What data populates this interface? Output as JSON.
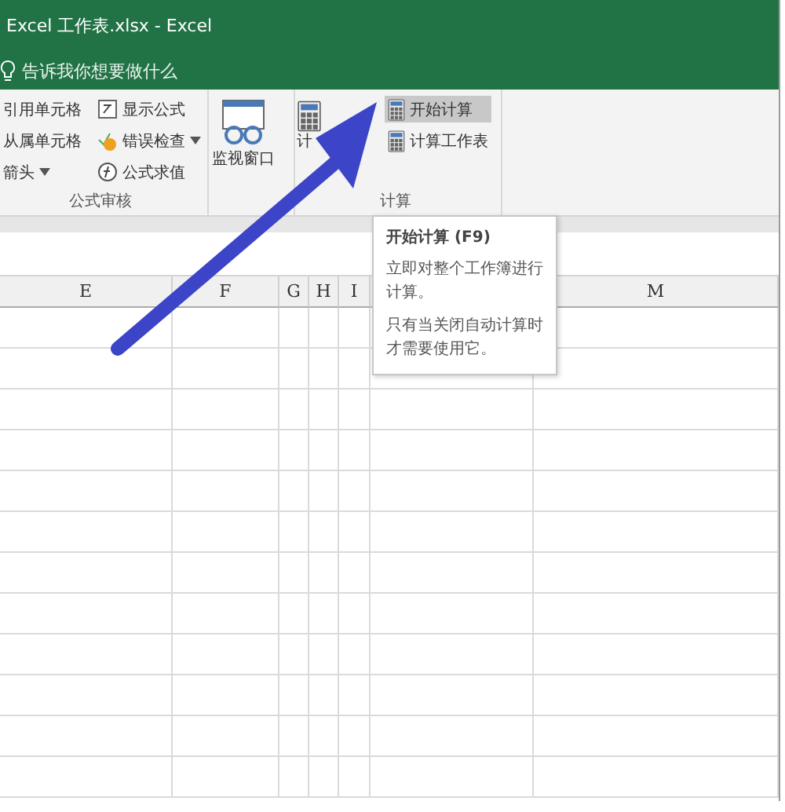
{
  "window": {
    "title": "Excel 工作表.xlsx  -  Excel"
  },
  "tell_me": {
    "placeholder": "告诉我你想要做什么"
  },
  "ribbon": {
    "audit_group": {
      "label": "公式审核",
      "columns": [
        [
          {
            "label": "引用单元格",
            "kind": "plain",
            "dropdown": false
          },
          {
            "label": "从属单元格",
            "kind": "plain",
            "dropdown": false
          },
          {
            "label": "箭头",
            "kind": "plain",
            "dropdown": true
          }
        ],
        [
          {
            "label": "显示公式",
            "kind": "formulas",
            "dropdown": false
          },
          {
            "label": "错误检查",
            "kind": "error",
            "dropdown": true
          },
          {
            "label": "公式求值",
            "kind": "evaluate",
            "dropdown": false
          }
        ]
      ]
    },
    "watch": {
      "label": "监视窗口"
    },
    "calc_group": {
      "label": "计算",
      "options_label": "计",
      "items": [
        {
          "label": "开始计算",
          "highlighted": true
        },
        {
          "label": "计算工作表",
          "highlighted": false
        }
      ]
    }
  },
  "tooltip": {
    "title": "开始计算 (F9)",
    "lines": [
      "立即对整个工作簿进行计算。",
      "只有当关闭自动计算时才需要使用它。"
    ]
  },
  "columns": [
    {
      "kind": "header",
      "label": "E"
    },
    {
      "kind": "header",
      "label": "F"
    },
    {
      "kind": "header",
      "label": "G"
    },
    {
      "kind": "header",
      "label": "H"
    },
    {
      "kind": "header",
      "label": "I"
    },
    {
      "kind": "covered"
    },
    {
      "kind": "header",
      "label": "M"
    }
  ]
}
